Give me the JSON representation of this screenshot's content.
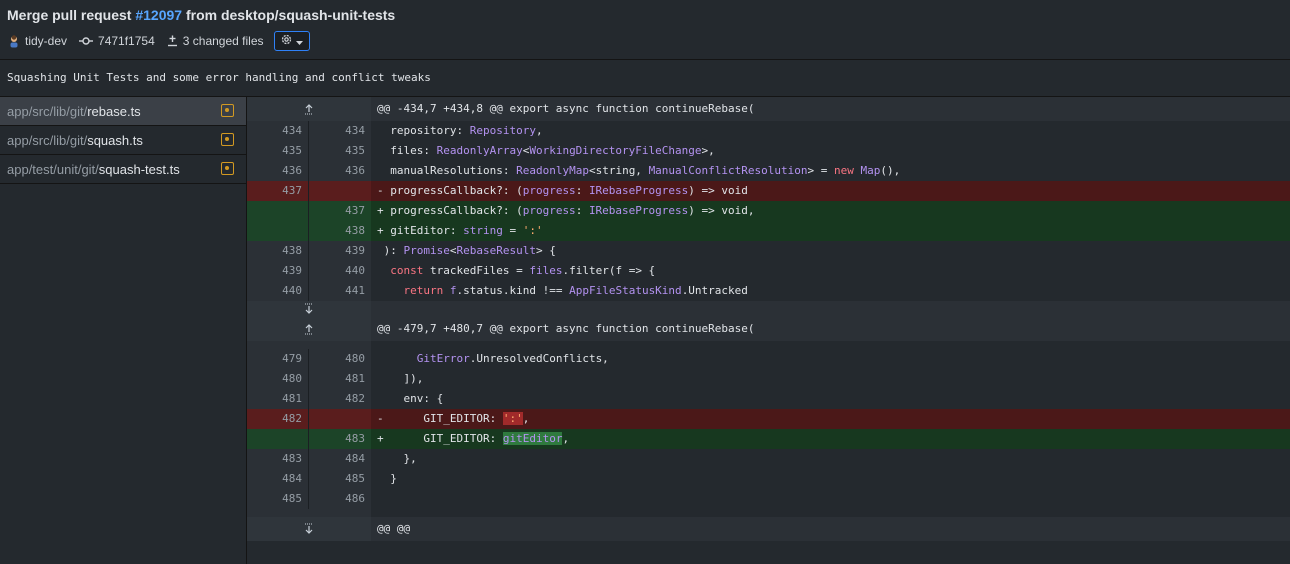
{
  "header": {
    "title_prefix": "Merge pull request ",
    "pr_number": "#12097",
    "title_suffix": " from desktop/squash-unit-tests",
    "author": "tidy-dev",
    "sha": "7471f1754",
    "changed_files": "3 changed files"
  },
  "commit": {
    "message": "Squashing Unit Tests and some error handling and conflict tweaks"
  },
  "files": [
    {
      "dir": "app/src/lib/git/",
      "name": "rebase.ts",
      "status": "modified",
      "selected": true
    },
    {
      "dir": "app/src/lib/git/",
      "name": "squash.ts",
      "status": "modified",
      "selected": false
    },
    {
      "dir": "app/test/unit/git/",
      "name": "squash-test.ts",
      "status": "modified",
      "selected": false
    }
  ],
  "diff": {
    "hunks": [
      {
        "header": "@@ -434,7 +434,8 @@ export async function continueRebase(",
        "lines": [
          {
            "type": "ctx",
            "old": "434",
            "new": "434"
          },
          {
            "type": "ctx",
            "old": "435",
            "new": "435"
          },
          {
            "type": "ctx",
            "old": "436",
            "new": "436"
          },
          {
            "type": "del",
            "old": "437",
            "new": ""
          },
          {
            "type": "add",
            "old": "",
            "new": "437"
          },
          {
            "type": "add",
            "old": "",
            "new": "438"
          },
          {
            "type": "ctx",
            "old": "438",
            "new": "439"
          },
          {
            "type": "ctx",
            "old": "439",
            "new": "440"
          },
          {
            "type": "ctx",
            "old": "440",
            "new": "441"
          }
        ]
      },
      {
        "header": "@@ -479,7 +480,7 @@ export async function continueRebase(",
        "lines": [
          {
            "type": "ctx",
            "old": "479",
            "new": "480"
          },
          {
            "type": "ctx",
            "old": "480",
            "new": "481"
          },
          {
            "type": "ctx",
            "old": "481",
            "new": "482"
          },
          {
            "type": "del",
            "old": "482",
            "new": ""
          },
          {
            "type": "add",
            "old": "",
            "new": "483"
          },
          {
            "type": "ctx",
            "old": "483",
            "new": "484"
          },
          {
            "type": "ctx",
            "old": "484",
            "new": "485"
          },
          {
            "type": "ctx",
            "old": "485",
            "new": "486"
          }
        ]
      }
    ],
    "trailing_header": "@@ @@",
    "code": {
      "l0": [
        "  ",
        "repository: ",
        "Repository",
        ","
      ],
      "l1": [
        "  ",
        "files: ",
        "ReadonlyArray",
        "<",
        "WorkingDirectoryFileChange",
        ">,"
      ],
      "l2": [
        "  ",
        "manualResolutions: ",
        "ReadonlyMap",
        "<string, ",
        "ManualConflictResolution",
        "> = ",
        "new",
        " ",
        "Map",
        "(),"
      ],
      "l3": [
        "- ",
        "progressCallback?: (",
        "progress",
        ": ",
        "IRebaseProgress",
        ") => void"
      ],
      "l4": [
        "+ ",
        "progressCallback?: (",
        "progress",
        ": ",
        "IRebaseProgress",
        ") => void,"
      ],
      "l5": [
        "+ ",
        "gitEditor: ",
        "string",
        " = ",
        "':'"
      ],
      "l6": [
        " ): ",
        "Promise",
        "<",
        "RebaseResult",
        "> {"
      ],
      "l7": [
        "  ",
        "const",
        " trackedFiles = ",
        "files",
        ".filter(f => {"
      ],
      "l8": [
        "    ",
        "return",
        " ",
        "f",
        ".status.kind !== ",
        "AppFileStatusKind",
        ".Untracked"
      ],
      "m0": [
        "      ",
        "GitError",
        ".UnresolvedConflicts,"
      ],
      "m1": [
        "    ]),"
      ],
      "m2": [
        "    env: {"
      ],
      "m3": [
        "-      GIT_EDITOR: ",
        "':'",
        ","
      ],
      "m4": [
        "+      GIT_EDITOR: ",
        "gitEditor",
        ","
      ],
      "m5": [
        "    },"
      ],
      "m6": [
        "  }"
      ],
      "m7": [
        ""
      ]
    },
    "colors": {
      "deleted_bg": "#4b1818",
      "added_bg": "#17381f",
      "link": "#58a6ff",
      "modified_status": "#d29922",
      "focus": "#2f81f7"
    }
  }
}
